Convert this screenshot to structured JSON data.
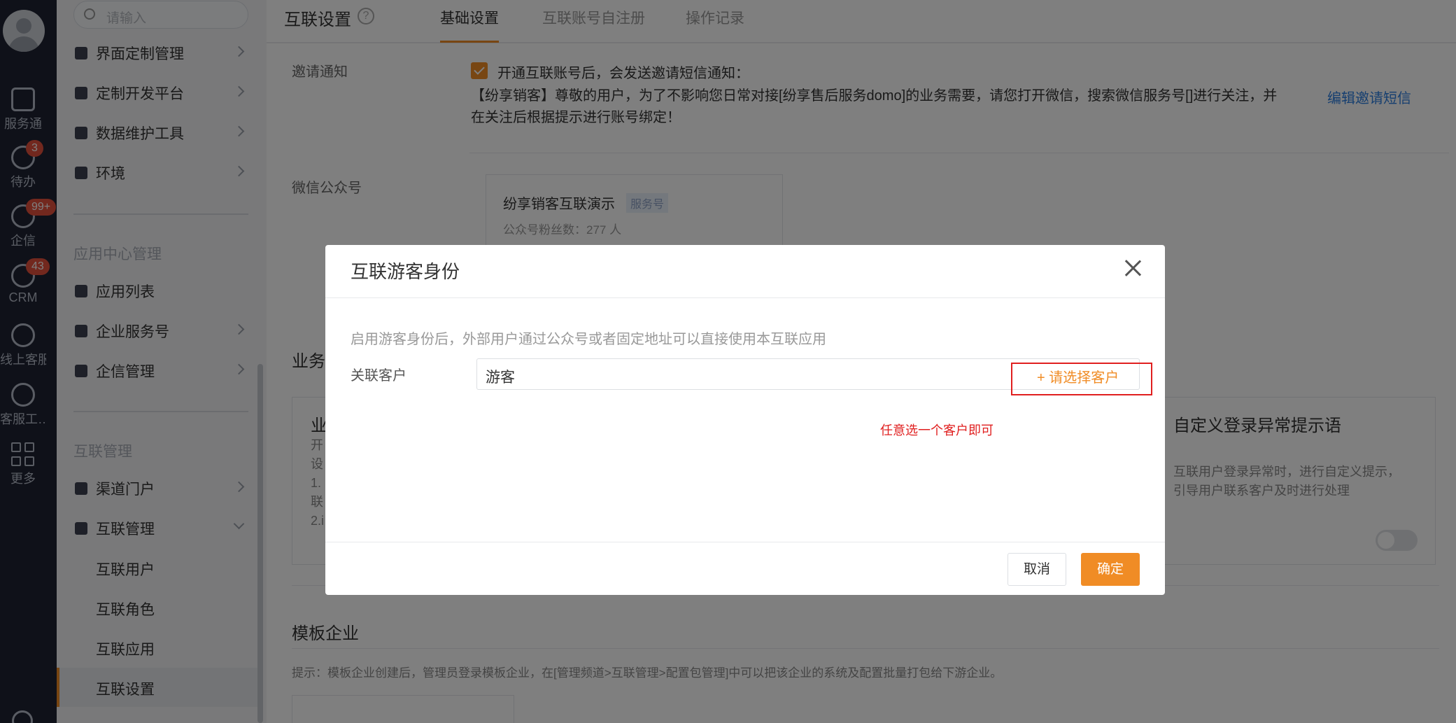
{
  "rail": {
    "items": [
      {
        "label": "服务通",
        "icon": "service-icon"
      },
      {
        "label": "待办",
        "icon": "check-circle-icon",
        "badge": "3"
      },
      {
        "label": "企信",
        "icon": "chat-icon",
        "badge": "99+"
      },
      {
        "label": "CRM",
        "icon": "clock-icon",
        "badge": "43"
      },
      {
        "label": "线上客服",
        "icon": "chat-smile-icon"
      },
      {
        "label": "客服工…",
        "icon": "headset-icon"
      },
      {
        "label": "更多",
        "icon": "grid-icon"
      }
    ]
  },
  "sidebar": {
    "search_placeholder": "请输入",
    "items_top": [
      {
        "label": "界面定制管理"
      },
      {
        "label": "定制开发平台"
      },
      {
        "label": "数据维护工具"
      },
      {
        "label": "环境"
      }
    ],
    "section_app": "应用中心管理",
    "items_app": [
      {
        "label": "应用列表"
      },
      {
        "label": "企业服务号"
      },
      {
        "label": "企信管理"
      }
    ],
    "section_link": "互联管理",
    "items_link": [
      {
        "label": "渠道门户"
      },
      {
        "label": "互联管理"
      }
    ],
    "sub_items": [
      {
        "label": "互联用户"
      },
      {
        "label": "互联角色"
      },
      {
        "label": "互联应用"
      },
      {
        "label": "互联设置"
      }
    ]
  },
  "header": {
    "title": "互联设置",
    "tabs": [
      {
        "label": "基础设置"
      },
      {
        "label": "互联账号自注册"
      },
      {
        "label": "操作记录"
      }
    ]
  },
  "settings": {
    "invite_label": "邀请通知",
    "invite_checkbox_text": "开通互联账号后，会发送邀请短信通知：",
    "invite_message": "【纷享销客】尊敬的用户，为了不影响您日常对接[纷享售后服务domo]的业务需要，请您打开微信，搜索微信服务号[]进行关注，并在关注后根据提示进行账号绑定！",
    "edit_invite_link": "编辑邀请短信",
    "wechat_label": "微信公众号",
    "wechat_name": "纷享销客互联演示",
    "wechat_tag": "服务号",
    "wechat_fans": "公众号粉丝数：277 人",
    "business_section_partial": "业务",
    "card_left_partial": {
      "title": "业",
      "lines": [
        "开",
        "设",
        "1.",
        "联",
        "2.i"
      ]
    },
    "card_right": {
      "title": "自定义登录异常提示语",
      "desc": "互联用户登录异常时，进行自定义提示，引导用户联系客户及时进行处理"
    },
    "template_title": "模板企业",
    "template_tip": "提示：模板企业创建后，管理员登录模板企业，在[管理频道>互联管理>配置包管理]中可以把该企业的系统及配置批量打包给下游企业。"
  },
  "modal": {
    "title": "互联游客身份",
    "description": "启用游客身份后，外部用户通过公众号或者固定地址可以直接使用本互联应用",
    "field_label": "关联客户",
    "field_value": "游客",
    "select_customer": "+ 请选择客户",
    "annotation": "任意选一个客户即可",
    "cancel": "取消",
    "confirm": "确定"
  }
}
